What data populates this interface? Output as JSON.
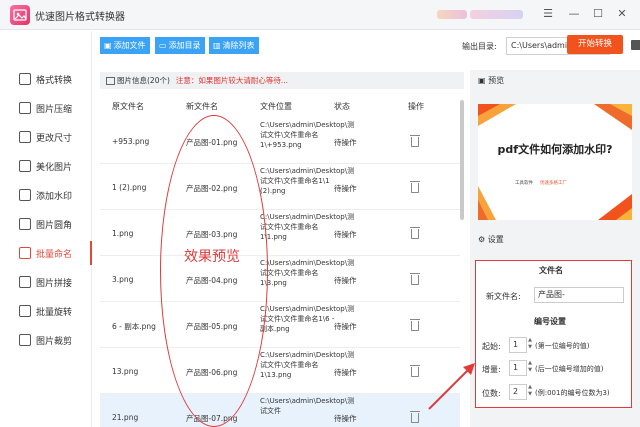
{
  "app": {
    "title": "优速图片格式转换器"
  },
  "sidebar": {
    "items": [
      {
        "label": "格式转换",
        "active": false
      },
      {
        "label": "图片压缩",
        "active": false
      },
      {
        "label": "更改尺寸",
        "active": false
      },
      {
        "label": "美化图片",
        "active": false
      },
      {
        "label": "添加水印",
        "active": false
      },
      {
        "label": "图片圆角",
        "active": false
      },
      {
        "label": "批量命名",
        "active": true
      },
      {
        "label": "图片拼接",
        "active": false
      },
      {
        "label": "批量旋转",
        "active": false
      },
      {
        "label": "图片裁剪",
        "active": false
      }
    ]
  },
  "toolbar": {
    "add_file": "添加文件",
    "add_folder": "添加目录",
    "clear_list": "清除列表",
    "output_label": "输出目录:",
    "output_path": "C:\\Users\\admin\\Deskto",
    "more": "...",
    "start": "开始转换"
  },
  "info": {
    "label": "图片信息",
    "count": "(20个)",
    "warning": "注意：如果图片较大请耐心等待..."
  },
  "table": {
    "headers": [
      "原文件名",
      "新文件名",
      "文件位置",
      "状态",
      "操作"
    ],
    "rows": [
      {
        "orig": "+953.png",
        "new": "产品图-01.png",
        "path": "C:\\Users\\admin\\Desktop\\测试文件\\文件重命名1\\+953.png",
        "status": "待操作"
      },
      {
        "orig": "1 (2).png",
        "new": "产品图-02.png",
        "path": "C:\\Users\\admin\\Desktop\\测试文件\\文件重命名1\\1 (2).png",
        "status": "待操作"
      },
      {
        "orig": "1.png",
        "new": "产品图-03.png",
        "path": "C:\\Users\\admin\\Desktop\\测试文件\\文件重命名1\\1.png",
        "status": "待操作"
      },
      {
        "orig": "3.png",
        "new": "产品图-04.png",
        "path": "C:\\Users\\admin\\Desktop\\测试文件\\文件重命名1\\3.png",
        "status": "待操作"
      },
      {
        "orig": "6 - 副本.png",
        "new": "产品图-05.png",
        "path": "C:\\Users\\admin\\Desktop\\测试文件\\文件重命名1\\6 - 副本.png",
        "status": "待操作"
      },
      {
        "orig": "13.png",
        "new": "产品图-06.png",
        "path": "C:\\Users\\admin\\Desktop\\测试文件\\文件重命名1\\13.png",
        "status": "待操作"
      },
      {
        "orig": "21.png",
        "new": "产品图-07.png",
        "path": "C:\\Users\\admin\\Desktop\\测试文件",
        "status": "待操作"
      }
    ]
  },
  "annotation": {
    "effect_label": "效果预览"
  },
  "preview": {
    "label": "预览",
    "image_title": "pdf文件如何添加水印?",
    "image_small": "工具软件",
    "image_small2": "优速多格工厂"
  },
  "settings": {
    "label": "设置",
    "filename_section": "文件名",
    "new_name_label": "新文件名:",
    "new_name_value": "产品图-",
    "numbering_section": "编号设置",
    "start_label": "起始:",
    "start_value": "1",
    "start_hint": "(第一位编号的值)",
    "step_label": "增量:",
    "step_value": "1",
    "step_hint": "(后一位编号增加的值)",
    "digits_label": "位数:",
    "digits_value": "2",
    "digits_hint": "(例:001的编号位数为3)"
  },
  "colors": {
    "accent": "#e04a3a",
    "toolbar_button": "#3aa3f5",
    "start_button": "#f2521c",
    "annotation": "#e03a3a"
  }
}
